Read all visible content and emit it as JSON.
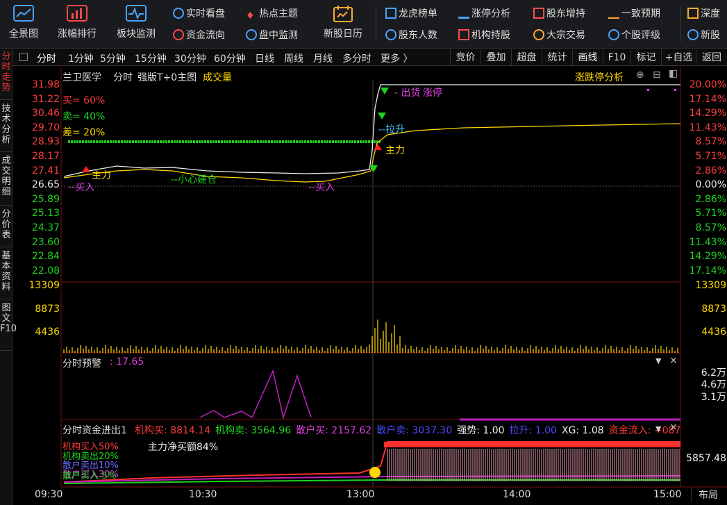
{
  "toolbar": {
    "big": [
      {
        "label": "全景图",
        "icon": "panorama-icon",
        "color": "#4aa3ff"
      },
      {
        "label": "涨幅排行",
        "icon": "bar-rank-icon",
        "color": "#ff4a4a"
      },
      {
        "label": "板块监测",
        "icon": "pulse-icon",
        "color": "#4aa3ff"
      },
      {
        "label": "新股日历",
        "icon": "calendar-icon",
        "color": "#ffaa33"
      }
    ],
    "small": [
      {
        "label": "实时看盘",
        "icon": "refresh-icon",
        "color": "#4aa3ff"
      },
      {
        "label": "热点主题",
        "icon": "flame-icon",
        "color": "#ff4a4a"
      },
      {
        "label": "资金流向",
        "icon": "flow-icon",
        "color": "#ff4a4a"
      },
      {
        "label": "盘中监测",
        "icon": "monitor-icon",
        "color": "#4aa3ff"
      },
      {
        "label": "龙虎榜单",
        "icon": "dragon-icon",
        "color": "#4aa3ff"
      },
      {
        "label": "涨停分析",
        "icon": "limitup-icon",
        "color": "#4aa3ff"
      },
      {
        "label": "股东增持",
        "icon": "trend-up-icon",
        "color": "#ff4a4a"
      },
      {
        "label": "一致预期",
        "icon": "wave-icon",
        "color": "#ffaa33"
      },
      {
        "label": "深度",
        "icon": "depth-icon",
        "color": "#ffaa33"
      },
      {
        "label": "股东人数",
        "icon": "people-icon",
        "color": "#4aa3ff"
      },
      {
        "label": "机构持股",
        "icon": "building-icon",
        "color": "#ff4a4a"
      },
      {
        "label": "大宗交易",
        "icon": "yen-icon",
        "color": "#ffaa33"
      },
      {
        "label": "个股评级",
        "icon": "rating-icon",
        "color": "#4aa3ff"
      },
      {
        "label": "新股",
        "icon": "newstock-icon",
        "color": "#4aa3ff"
      }
    ]
  },
  "left_tabs": [
    "分时走势",
    "技术分析",
    "成交明细",
    "分价表",
    "基本资料",
    "图文F10"
  ],
  "period_tabs": [
    "分时",
    "1分钟",
    "5分钟",
    "15分钟",
    "30分钟",
    "60分钟",
    "日线",
    "周线",
    "月线",
    "多分时",
    "更多 〉"
  ],
  "right_tabs": [
    "竞价",
    "叠加",
    "超盘",
    "统计",
    "画线",
    "F10",
    "标记",
    "+自选",
    "返回"
  ],
  "header": {
    "stock": "兰卫医学",
    "mode": "分时",
    "indicator": "强版T+0主图",
    "volume": "成交量",
    "right": "涨跌停分析"
  },
  "legend": {
    "buy": "买= 60%",
    "sell": "卖= 40%",
    "diff": "差= 20%"
  },
  "price_left": [
    "31.98",
    "31.22",
    "30.46",
    "29.70",
    "28.93",
    "28.17",
    "27.41",
    "26.65",
    "25.89",
    "25.13",
    "24.37",
    "23.60",
    "22.84",
    "22.08"
  ],
  "price_colors": [
    "red",
    "red",
    "red",
    "red",
    "red",
    "red",
    "red",
    "white",
    "green",
    "green",
    "green",
    "green",
    "green",
    "green"
  ],
  "pct_right": [
    "20.00%",
    "17.14%",
    "14.29%",
    "11.43%",
    "8.57%",
    "5.71%",
    "2.86%",
    "0.00%",
    "2.86%",
    "5.71%",
    "8.57%",
    "11.43%",
    "14.29%",
    "17.14%"
  ],
  "vol_axis": [
    "13309",
    "8873",
    "4436"
  ],
  "annotations": {
    "sell_limit": "出货",
    "limit": "涨停",
    "pull": "拉升",
    "main": "主力",
    "main2": "主力",
    "buy1": "买入",
    "buy2": "买入",
    "small": "小心建仓"
  },
  "warn": {
    "title": "分时预警",
    "value": ": 17.65",
    "axis": [
      "6.2万",
      "4.6万",
      "3.1万"
    ]
  },
  "fund": {
    "title": "分时资金进出1",
    "items": [
      {
        "label": "机构买: 8814.14",
        "color": "#ff3c3c"
      },
      {
        "label": "机构卖: 3564.96",
        "color": "#1fd31f"
      },
      {
        "label": "散户买: 2157.62",
        "color": "#e040e0"
      },
      {
        "label": "散户卖: 3037.30",
        "color": "#4a4aff"
      },
      {
        "label": "强势: 1.00",
        "color": "#eee"
      },
      {
        "label": "拉升: 1.00",
        "color": "#4a4aff"
      },
      {
        "label": "XG: 1.08",
        "color": "#eee"
      },
      {
        "label": "资金流入: +087",
        "color": "#ff3c3c"
      }
    ],
    "net": "主力净买额84%",
    "axis": "5857.48",
    "lines": [
      "机构买入50%",
      "机构卖出20%",
      "散户卖出10%",
      "散户买入30%",
      "散户买入-5%"
    ]
  },
  "x_labels": [
    "09:30",
    "10:30",
    "13:00",
    "14:00",
    "15:00"
  ],
  "layout_btn": "布局"
}
